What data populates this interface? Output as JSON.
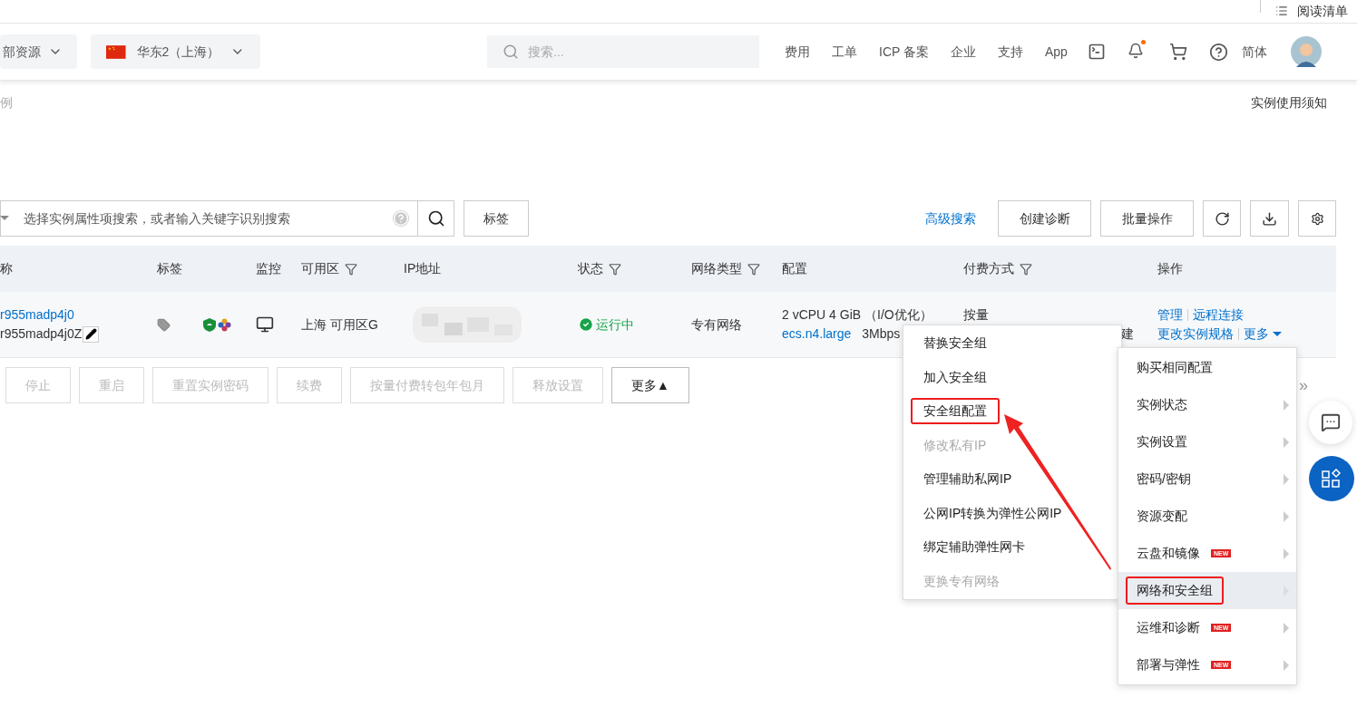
{
  "top_bar": {
    "reading_list": "阅读清单"
  },
  "header": {
    "resource_group": "部资源",
    "region": "华东2（上海）",
    "search": {
      "placeholder": "搜索..."
    },
    "nav_links": [
      "费用",
      "工单",
      "ICP 备案",
      "企业",
      "支持",
      "App"
    ],
    "unread_notifications": true,
    "language": "简体"
  },
  "breadcrumb": "例",
  "notice_link": "实例使用须知",
  "filter": {
    "placeholder": "选择实例属性项搜索，或者输入关键字识别搜索",
    "tag_button": "标签",
    "advanced_search": "高级搜索",
    "buttons": [
      "创建诊断",
      "批量操作"
    ]
  },
  "table": {
    "columns": [
      {
        "label": "称",
        "filter": false
      },
      {
        "label": "标签",
        "filter": false
      },
      {
        "label": "监控",
        "filter": false
      },
      {
        "label": "可用区",
        "filter": true
      },
      {
        "label": "IP地址",
        "filter": false
      },
      {
        "label": "状态",
        "filter": true
      },
      {
        "label": "网络类型",
        "filter": true
      },
      {
        "label": "配置",
        "filter": false
      },
      {
        "label": "付费方式",
        "filter": true
      },
      {
        "label": "操作",
        "filter": false
      }
    ],
    "rows": [
      {
        "name": "r955madp4j0",
        "id": "r955madp4j0Z",
        "zone": "上海 可用区G",
        "status": "运行中",
        "network": "专有网络",
        "config": "2 vCPU 4 GiB （I/O优化）",
        "instance_type": "ecs.n4.large",
        "bandwidth": "3Mbps",
        "billing": "按量",
        "column_9": "建",
        "actions": [
          "管理",
          "远程连接",
          "更改实例规格",
          "更多"
        ]
      }
    ]
  },
  "bulk_actions": [
    {
      "label": "停止",
      "disabled": true
    },
    {
      "label": "重启",
      "disabled": true
    },
    {
      "label": "重置实例密码",
      "disabled": true
    },
    {
      "label": "续费",
      "disabled": true
    },
    {
      "label": "按量付费转包年包月",
      "disabled": true
    },
    {
      "label": "释放设置",
      "disabled": true
    },
    {
      "label": "更多▲",
      "disabled": false
    }
  ],
  "pagination_next": "»",
  "more_menu": {
    "items": [
      {
        "label": "购买相同配置",
        "kind": "action",
        "selected": false,
        "highlighted": false
      },
      {
        "label": "实例状态",
        "kind": "submenu",
        "selected": false,
        "highlighted": false
      },
      {
        "label": "实例设置",
        "kind": "submenu",
        "selected": false,
        "highlighted": false
      },
      {
        "label": "密码/密钥",
        "kind": "submenu",
        "selected": false,
        "highlighted": false
      },
      {
        "label": "资源变配",
        "kind": "submenu",
        "selected": false,
        "highlighted": false
      },
      {
        "label": "云盘和镜像",
        "kind": "submenu",
        "badge": "NEW",
        "selected": false,
        "highlighted": false
      },
      {
        "label": "网络和安全组",
        "kind": "submenu",
        "selected": true,
        "highlighted": true
      },
      {
        "label": "运维和诊断",
        "kind": "submenu",
        "badge": "NEW",
        "selected": false,
        "highlighted": false
      },
      {
        "label": "部署与弹性",
        "kind": "submenu",
        "badge": "NEW",
        "selected": false,
        "highlighted": false
      }
    ]
  },
  "network_submenu": {
    "items": [
      {
        "label": "替换安全组",
        "disabled": false,
        "highlighted": false
      },
      {
        "label": "加入安全组",
        "disabled": false,
        "highlighted": false
      },
      {
        "label": "安全组配置",
        "disabled": false,
        "highlighted": true
      },
      {
        "label": "修改私有IP",
        "disabled": true,
        "highlighted": false
      },
      {
        "label": "管理辅助私网IP",
        "disabled": false,
        "highlighted": false
      },
      {
        "label": "公网IP转换为弹性公网IP",
        "disabled": false,
        "highlighted": false
      },
      {
        "label": "绑定辅助弹性网卡",
        "disabled": false,
        "highlighted": false
      },
      {
        "label": "更换专有网络",
        "disabled": true,
        "highlighted": false
      }
    ]
  }
}
